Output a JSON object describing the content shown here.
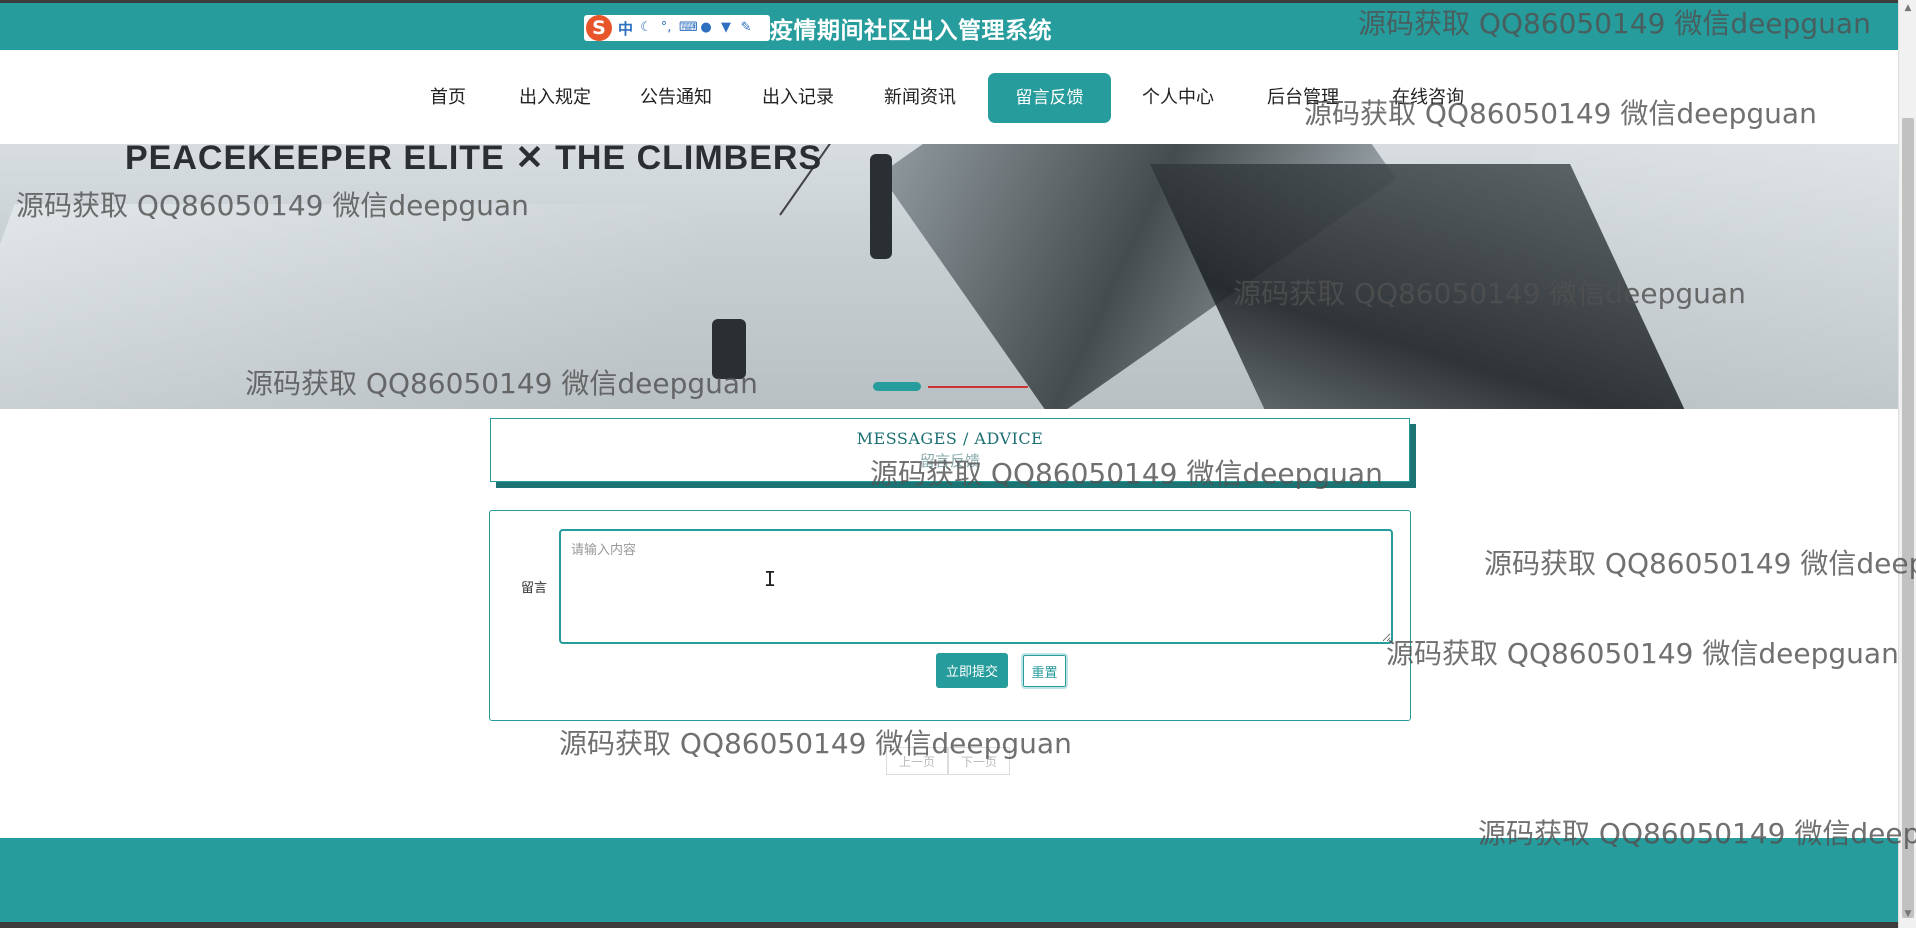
{
  "app": {
    "title": "疫情期间社区出入管理系统",
    "ime": {
      "char": "中",
      "logo": "S"
    }
  },
  "nav": {
    "items": [
      {
        "label": "首页"
      },
      {
        "label": "出入规定"
      },
      {
        "label": "公告通知"
      },
      {
        "label": "出入记录"
      },
      {
        "label": "新闻资讯"
      },
      {
        "label": "留言反馈",
        "active": true
      },
      {
        "label": "个人中心"
      },
      {
        "label": "后台管理"
      },
      {
        "label": "在线咨询"
      }
    ]
  },
  "banner": {
    "text": "PEACEKEEPER ELITE  ✕  THE CLIMBERS"
  },
  "section": {
    "title_en": "MESSAGES / ADVICE",
    "title_cn": "留言反馈"
  },
  "form": {
    "label": "留言",
    "placeholder": "请输入内容",
    "value": "",
    "submit_label": "立即提交",
    "reset_label": "重置"
  },
  "pager": {
    "prev_label": "上一页",
    "next_label": "下一页"
  },
  "watermark": {
    "text": "源码获取 QQ86050149 微信deepguan"
  },
  "colors": {
    "accent": "#279c9c",
    "accent_dark": "#1c7373",
    "footer": "#279c9c"
  }
}
